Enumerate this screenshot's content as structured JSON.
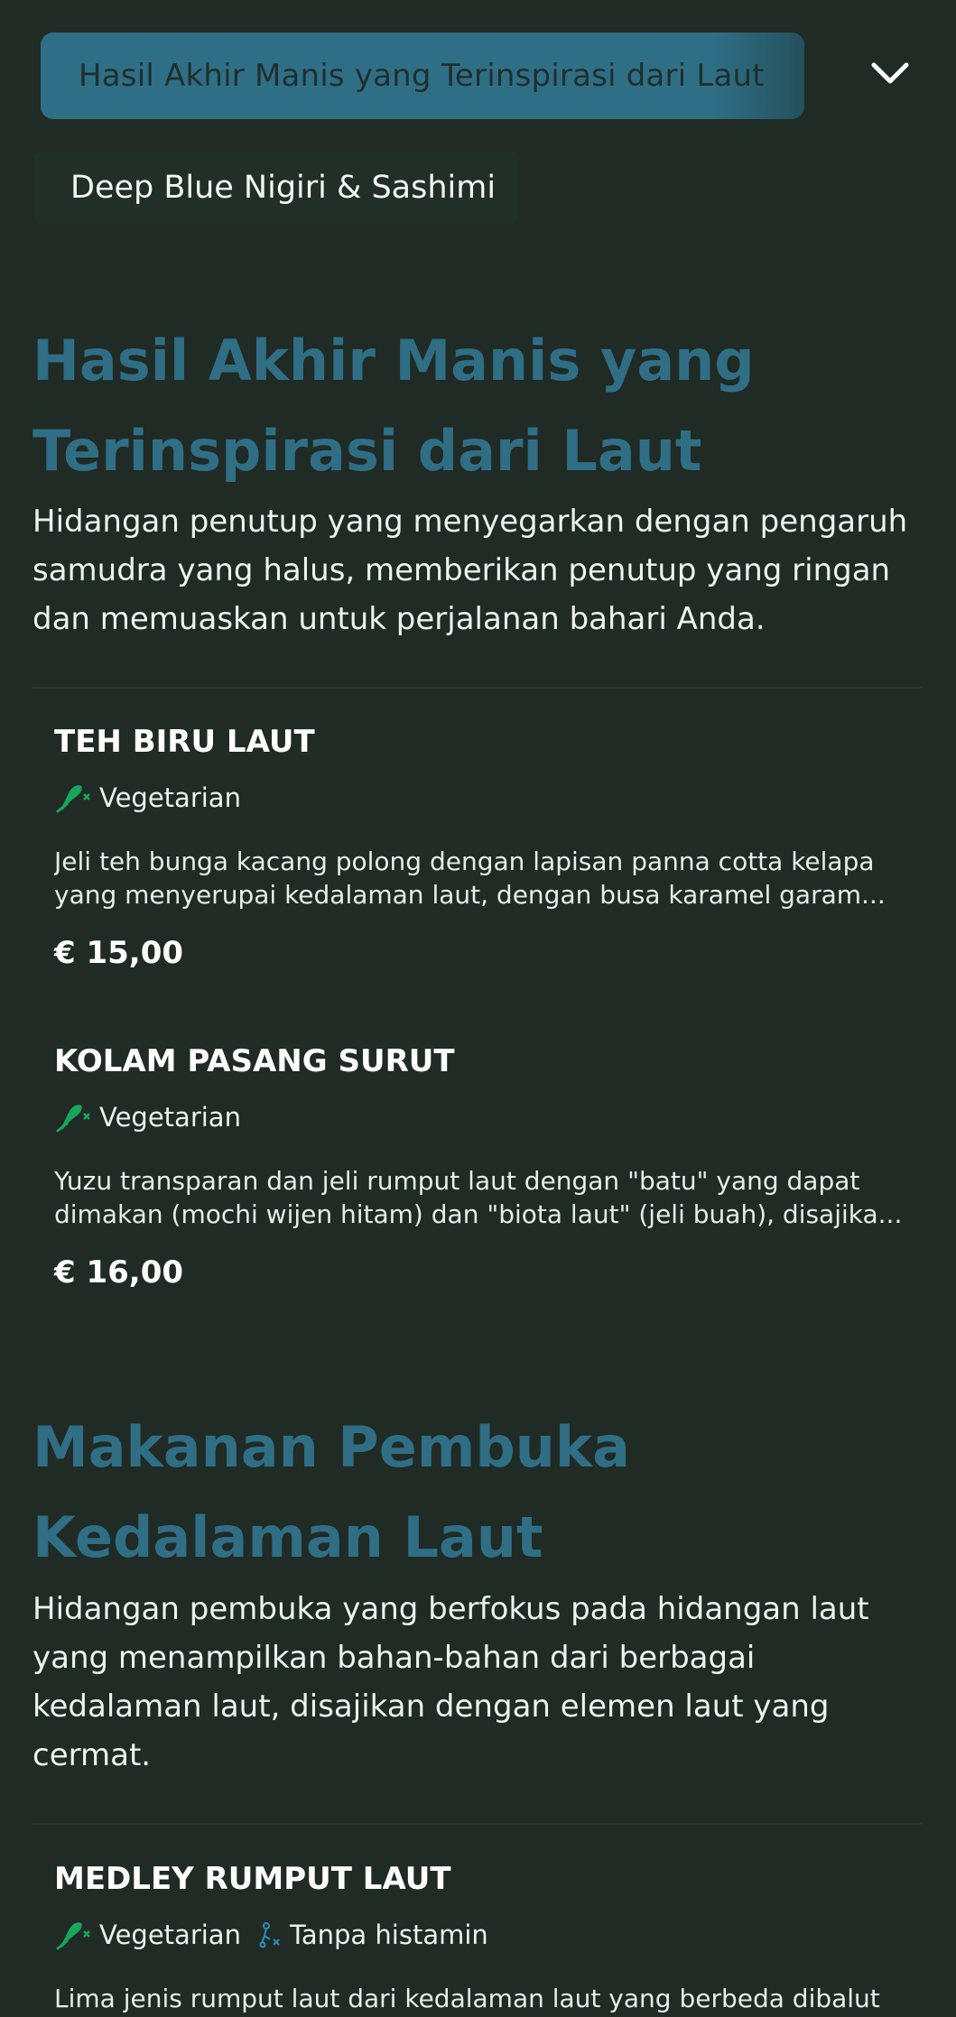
{
  "header": {
    "category_label": "Hasil Akhir Manis yang Terinspirasi dari Laut",
    "subcategory_label": "Deep Blue Nigiri & Sashimi"
  },
  "colors": {
    "background": "#1f2b24",
    "accent_pill": "#2f6f86",
    "section_title": "#2f6e85",
    "vegetarian_icon": "#18a55c",
    "histamine_icon": "#2f8fb5"
  },
  "sections": [
    {
      "title_line1": "Hasil Akhir Manis yang",
      "title_line2": "Terinspirasi dari Laut",
      "description": "Hidangan penutup yang menyegarkan dengan pengaruh samudra yang halus, memberikan penutup yang ringan dan memuaskan untuk perjalanan bahari Anda.",
      "items": [
        {
          "name": "TEH BIRU LAUT",
          "tags": [
            "Vegetarian"
          ],
          "description": "Jeli teh bunga kacang polong dengan lapisan panna cotta kelapa yang menyerupai kedalaman laut, dengan busa karamel garam...",
          "price": "€ 15,00"
        },
        {
          "name": "KOLAM PASANG SURUT",
          "tags": [
            "Vegetarian"
          ],
          "description": "Yuzu transparan dan jeli rumput laut dengan \"batu\" yang dapat dimakan (mochi wijen hitam) dan \"biota laut\" (jeli buah), disajika...",
          "price": "€ 16,00"
        }
      ]
    },
    {
      "title_line1": "Makanan Pembuka",
      "title_line2": "Kedalaman Laut",
      "description": "Hidangan pembuka yang berfokus pada hidangan laut yang menampilkan bahan-bahan dari berbagai kedalaman laut, disajikan dengan elemen laut yang cermat.",
      "items": [
        {
          "name": "MEDLEY RUMPUT LAUT",
          "tags": [
            "Vegetarian",
            "Tanpa histamin"
          ],
          "description": "Lima jenis rumput laut dari kedalaman laut yang berbeda dibalut"
        }
      ]
    }
  ],
  "icons": {
    "chevron": "chevron-down-icon",
    "vegetarian": "vegetarian-leaf-icon",
    "histamine_free": "histamine-free-icon"
  }
}
